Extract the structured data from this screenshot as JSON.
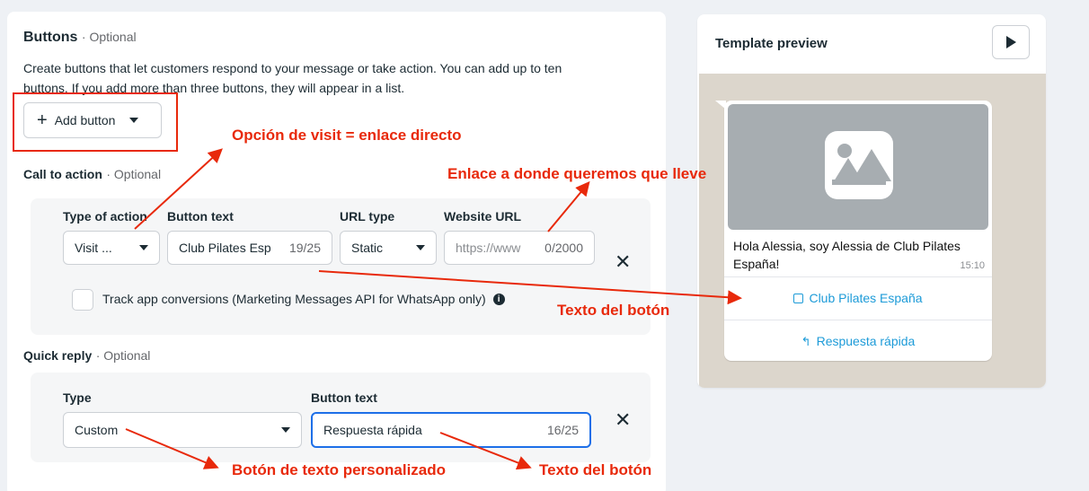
{
  "buttons_section": {
    "title": "Buttons",
    "optional": "· Optional",
    "description_line1": "Create buttons that let customers respond to your message or take action. You can add up to ten",
    "description_line2": "buttons. If you add more than three buttons, they will appear in a list.",
    "add_button_label": "Add button",
    "plus_glyph": "+"
  },
  "call_to_action": {
    "label": "Call to action",
    "optional": "· Optional",
    "type_of_action_label": "Type of action",
    "type_of_action_value": "Visit ...",
    "button_text_label": "Button text",
    "button_text_value": "Club Pilates Esp",
    "button_text_counter": "19/25",
    "url_type_label": "URL type",
    "url_type_value": "Static",
    "website_url_label": "Website URL",
    "website_url_placeholder": "https://www",
    "website_url_counter": "0/2000",
    "remove_glyph": "✕",
    "track_label": "Track app conversions (Marketing Messages API for WhatsApp only)"
  },
  "quick_reply": {
    "label": "Quick reply",
    "optional": "· Optional",
    "type_label": "Type",
    "type_value": "Custom",
    "button_text_label": "Button text",
    "button_text_value": "Respuesta rápida",
    "button_text_counter": "16/25",
    "remove_glyph": "✕"
  },
  "preview": {
    "title": "Template preview",
    "message_text": "Hola Alessia, soy Alessia de Club Pilates España!",
    "timestamp": "15:10",
    "cta_button_label": "Club Pilates España",
    "quick_reply_label": "Respuesta rápida"
  },
  "annotations": {
    "visit_option": "Opción de visit = enlace directo",
    "link_target": "Enlace a donde queremos que lleve",
    "button_text_1": "Texto del botón",
    "custom_text_button": "Botón de texto personalizado",
    "button_text_2": "Texto del botón"
  },
  "colors": {
    "annotation": "#e8290b",
    "link_blue": "#1d9bd8",
    "media_placeholder": "#a7adb1",
    "chat_background": "#dcd6cc"
  }
}
